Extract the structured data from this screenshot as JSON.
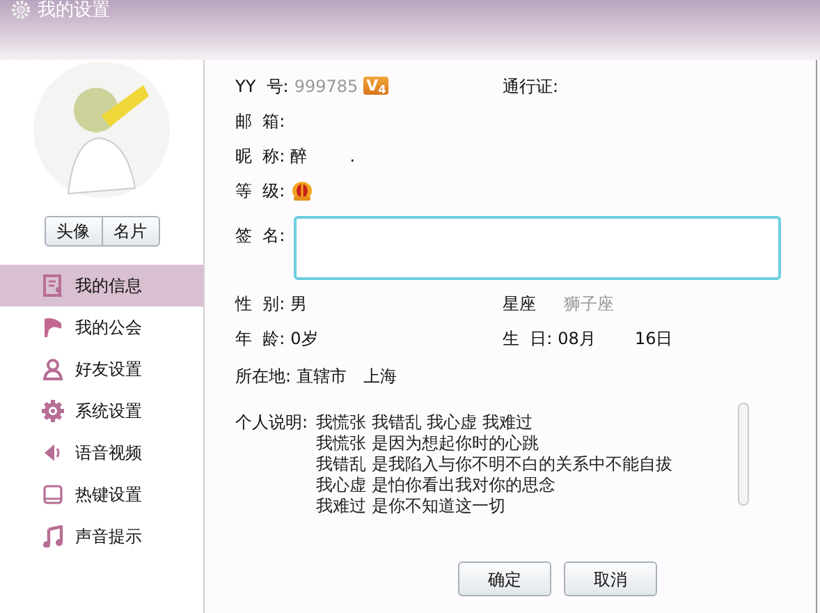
{
  "window": {
    "title": "我的设置"
  },
  "avatar_buttons": [
    {
      "label": "头像"
    },
    {
      "label": "名片"
    }
  ],
  "nav": [
    {
      "label": "我的信息",
      "selected": true
    },
    {
      "label": "我的公会",
      "selected": false
    },
    {
      "label": "好友设置",
      "selected": false
    },
    {
      "label": "系统设置",
      "selected": false
    },
    {
      "label": "语音视频",
      "selected": false
    },
    {
      "label": "热键设置",
      "selected": false
    },
    {
      "label": "声音提示",
      "selected": false
    }
  ],
  "info_rows": [
    {
      "label": "YY  号:",
      "value": "999785",
      "badge": "V$_{4}$",
      "right_label": "通行证:"
    },
    {
      "label": "邮  箱:"
    },
    {
      "label": "昵  称:",
      "value": "醉        ."
    },
    {
      "label": "等  级:",
      "crown": true
    }
  ],
  "signature": {
    "label": "签  名:"
  },
  "detail_rows": [
    {
      "label": "性  别:",
      "values": [
        "男"
      ],
      "right_label": "星座",
      "right_values": [
        "狮子座"
      ],
      "right_muted": true
    },
    {
      "label": "年  龄:",
      "values": [
        "0岁"
      ],
      "right_label": "生  日:",
      "right_values": [
        "08月",
        "16日"
      ],
      "right_muted": false
    },
    {
      "label": "所在地:",
      "values": [
        "直辖市",
        "上海"
      ]
    }
  ],
  "bio": {
    "label": "个人说明:",
    "lines": [
      "我慌张 我错乱 我心虚 我难过",
      "我慌张 是因为想起你时的心跳",
      "我错乱 是我陷入与你不明不白的关系中不能自拔",
      "我心虚 是怕你看出我对你的思念",
      "我难过 是你不知道这一切"
    ]
  },
  "buttons": [
    {
      "label": "确定"
    },
    {
      "label": "取消"
    }
  ]
}
